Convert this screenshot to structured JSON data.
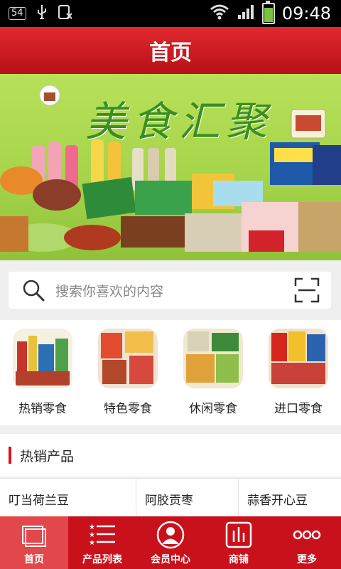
{
  "statusbar": {
    "notification_count": "54",
    "time": "09:48",
    "icons": [
      "notification-badge",
      "usb-icon",
      "sim-card-icon",
      "wifi-icon",
      "signal-icon",
      "battery-charging-icon"
    ]
  },
  "header": {
    "title": "首页"
  },
  "banner": {
    "title": "美食汇聚",
    "slide_count": 4,
    "active_slide": 2
  },
  "search": {
    "placeholder": "搜索你喜欢的内容",
    "icon": "search-icon",
    "scan_icon": "scan-icon"
  },
  "categories": [
    {
      "label": "热销零食",
      "icon": "hot-snacks-image"
    },
    {
      "label": "特色零食",
      "icon": "specialty-snacks-image"
    },
    {
      "label": "休闲零食",
      "icon": "leisure-snacks-image"
    },
    {
      "label": "进口零食",
      "icon": "imported-snacks-image"
    }
  ],
  "hot_section": {
    "title": "热销产品",
    "items": [
      "叮当荷兰豆",
      "阿胶贡枣",
      "蒜香开心豆"
    ]
  },
  "nav": [
    {
      "label": "首页",
      "icon": "home-icon",
      "active": true
    },
    {
      "label": "产品列表",
      "icon": "list-icon",
      "active": false
    },
    {
      "label": "会员中心",
      "icon": "user-icon",
      "active": false
    },
    {
      "label": "商铺",
      "icon": "shop-icon",
      "active": false
    },
    {
      "label": "更多",
      "icon": "more-icon",
      "active": false
    }
  ],
  "colors": {
    "brand": "#c9111b",
    "accent": "#d7141e",
    "nav_active": "#e2474c"
  }
}
